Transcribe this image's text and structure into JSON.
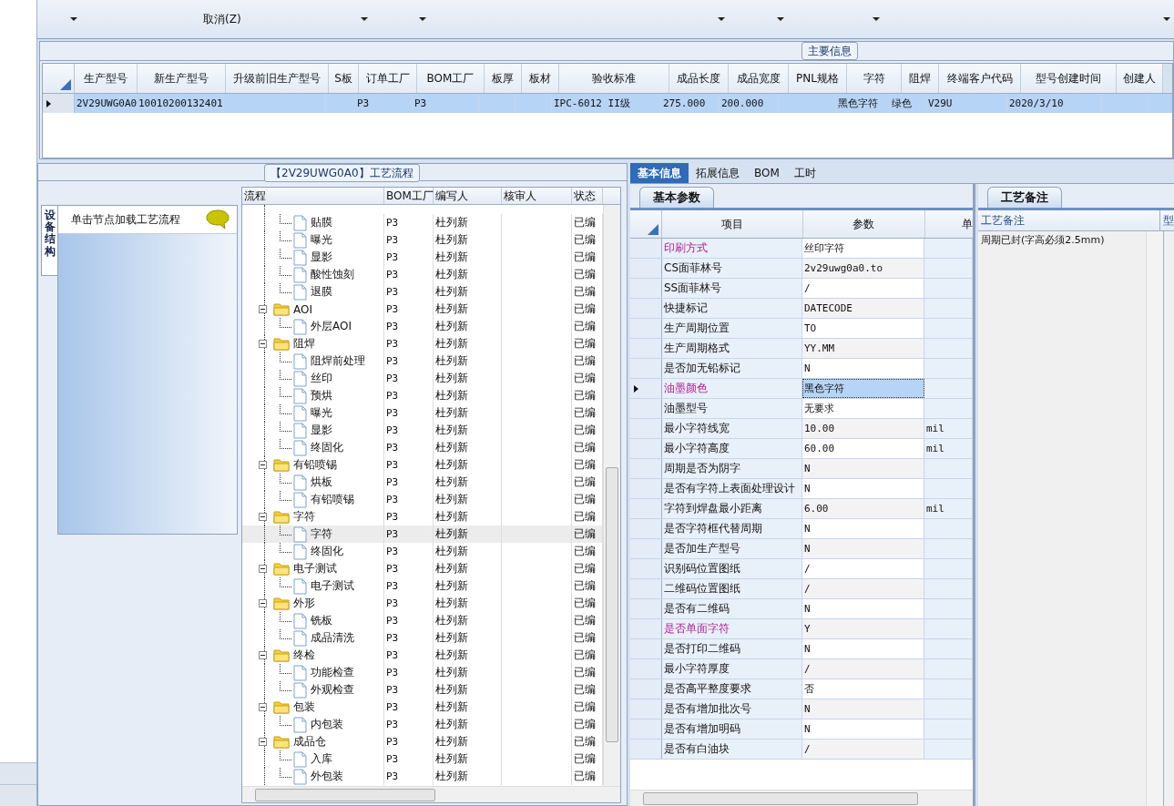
{
  "toolbar": {
    "menu_item": "取消(Z)"
  },
  "main_info": {
    "title": "主要信息",
    "columns": [
      "生产型号",
      "新生产型号",
      "升级前旧生产型号",
      "S板",
      "订单工厂",
      "BOM工厂",
      "板厚",
      "板材",
      "验收标准",
      "成品长度",
      "成品宽度",
      "PNL规格",
      "字符",
      "阻焊",
      "终端客户代码",
      "型号创建时间",
      "创建人"
    ],
    "rows": [
      {
        "selected": true,
        "cells": [
          "2V29UWG0A0",
          "10010200132401",
          null,
          null,
          "P3",
          "P3",
          null,
          null,
          "IPC-6012 II级",
          "275.000",
          "200.000",
          null,
          "黑色字符",
          "绿色",
          "V29U",
          "2020/3/10",
          null
        ]
      }
    ]
  },
  "flow": {
    "title": "【2V29UWG0A0】工艺流程",
    "side_tab": {
      "label": "设备结构",
      "selected": true
    },
    "hint": "单击节点加载工艺流程",
    "columns": [
      "流程",
      "BOM工厂",
      "编写人",
      "核审人",
      "状态"
    ],
    "tree": [
      {
        "children": [
          {
            "name": "贴膜",
            "bom": "P3",
            "writer": "杜列新",
            "status": "已编",
            "selected": false
          },
          {
            "name": "曝光",
            "bom": "P3",
            "writer": "杜列新",
            "status": "已编",
            "selected": false
          },
          {
            "name": "显影",
            "bom": "P3",
            "writer": "杜列新",
            "status": "已编",
            "selected": false
          },
          {
            "name": "酸性蚀刻",
            "bom": "P3",
            "writer": "杜列新",
            "status": "已编",
            "selected": false
          },
          {
            "name": "退膜",
            "bom": "P3",
            "writer": "杜列新",
            "status": "已编",
            "selected": false
          }
        ]
      },
      {
        "name": "AOI",
        "bom": "P3",
        "writer": "杜列新",
        "status": "已编",
        "expanded": true,
        "children": [
          {
            "name": "外层AOI",
            "bom": "P3",
            "writer": "杜列新",
            "status": "已编",
            "selected": false
          }
        ]
      },
      {
        "name": "阻焊",
        "bom": "P3",
        "writer": "杜列新",
        "status": "已编",
        "expanded": true,
        "children": [
          {
            "name": "阻焊前处理",
            "bom": "P3",
            "writer": "杜列新",
            "status": "已编",
            "selected": false
          },
          {
            "name": "丝印",
            "bom": "P3",
            "writer": "杜列新",
            "status": "已编",
            "selected": false
          },
          {
            "name": "预烘",
            "bom": "P3",
            "writer": "杜列新",
            "status": "已编",
            "selected": false
          },
          {
            "name": "曝光",
            "bom": "P3",
            "writer": "杜列新",
            "status": "已编",
            "selected": false
          },
          {
            "name": "显影",
            "bom": "P3",
            "writer": "杜列新",
            "status": "已编",
            "selected": false
          },
          {
            "name": "终固化",
            "bom": "P3",
            "writer": "杜列新",
            "status": "已编",
            "selected": false
          }
        ]
      },
      {
        "name": "有铅喷锡",
        "bom": "P3",
        "writer": "杜列新",
        "status": "已编",
        "expanded": true,
        "children": [
          {
            "name": "烘板",
            "bom": "P3",
            "writer": "杜列新",
            "status": "已编",
            "selected": false
          },
          {
            "name": "有铅喷锡",
            "bom": "P3",
            "writer": "杜列新",
            "status": "已编",
            "selected": false
          }
        ]
      },
      {
        "name": "字符",
        "bom": "P3",
        "writer": "杜列新",
        "status": "已编",
        "expanded": true,
        "children": [
          {
            "name": "字符",
            "bom": "P3",
            "writer": "杜列新",
            "status": "已编",
            "selected": true
          },
          {
            "name": "终固化",
            "bom": "P3",
            "writer": "杜列新",
            "status": "已编",
            "selected": false
          }
        ]
      },
      {
        "name": "电子测试",
        "bom": "P3",
        "writer": "杜列新",
        "status": "已编",
        "expanded": true,
        "children": [
          {
            "name": "电子测试",
            "bom": "P3",
            "writer": "杜列新",
            "status": "已编",
            "selected": false
          }
        ]
      },
      {
        "name": "外形",
        "bom": "P3",
        "writer": "杜列新",
        "status": "已编",
        "expanded": true,
        "children": [
          {
            "name": "铣板",
            "bom": "P3",
            "writer": "杜列新",
            "status": "已编",
            "selected": false
          },
          {
            "name": "成品清洗",
            "bom": "P3",
            "writer": "杜列新",
            "status": "已编",
            "selected": false
          }
        ]
      },
      {
        "name": "终检",
        "bom": "P3",
        "writer": "杜列新",
        "status": "已编",
        "expanded": true,
        "children": [
          {
            "name": "功能检查",
            "bom": "P3",
            "writer": "杜列新",
            "status": "已编",
            "selected": false
          },
          {
            "name": "外观检查",
            "bom": "P3",
            "writer": "杜列新",
            "status": "已编",
            "selected": false
          }
        ]
      },
      {
        "name": "包装",
        "bom": "P3",
        "writer": "杜列新",
        "status": "已编",
        "expanded": true,
        "children": [
          {
            "name": "内包装",
            "bom": "P3",
            "writer": "杜列新",
            "status": "已编",
            "selected": false
          }
        ]
      },
      {
        "name": "成品仓",
        "bom": "P3",
        "writer": "杜列新",
        "status": "已编",
        "expanded": true,
        "children": [
          {
            "name": "入库",
            "bom": "P3",
            "writer": "杜列新",
            "status": "已编",
            "selected": false
          },
          {
            "name": "外包装",
            "bom": "P3",
            "writer": "杜列新",
            "status": "已编",
            "selected": false
          }
        ]
      }
    ]
  },
  "detail_tabs": [
    {
      "label": "基本信息",
      "selected": true
    },
    {
      "label": "拓展信息",
      "selected": false
    },
    {
      "label": "BOM",
      "selected": false
    },
    {
      "label": "工时",
      "selected": false
    }
  ],
  "params": {
    "tab": {
      "label": "基本参数",
      "selected": true
    },
    "columns": [
      "项目",
      "参数",
      "单"
    ],
    "rows": [
      {
        "item": "印刷方式",
        "value": "丝印字符",
        "emphasized": true,
        "selected": false
      },
      {
        "item": "CS面菲林号",
        "value": "2v29uwg0a0.to",
        "emphasized": false,
        "selected": false
      },
      {
        "item": "SS面菲林号",
        "value": "/",
        "emphasized": false,
        "selected": false
      },
      {
        "item": "快捷标记",
        "value": "DATECODE",
        "emphasized": false,
        "selected": false
      },
      {
        "item": "生产周期位置",
        "value": "TO",
        "emphasized": false,
        "selected": false
      },
      {
        "item": "生产周期格式",
        "value": "YY.MM",
        "emphasized": false,
        "selected": false
      },
      {
        "item": "是否加无铅标记",
        "value": "N",
        "emphasized": false,
        "selected": false
      },
      {
        "item": "油墨颜色",
        "value": "黑色字符",
        "emphasized": true,
        "selected": true
      },
      {
        "item": "油墨型号",
        "value": "无要求",
        "emphasized": false,
        "selected": false
      },
      {
        "item": "最小字符线宽",
        "value": "10.00",
        "unit": "mil",
        "emphasized": false,
        "selected": false
      },
      {
        "item": "最小字符高度",
        "value": "60.00",
        "unit": "mil",
        "emphasized": false,
        "selected": false
      },
      {
        "item": "周期是否为阴字",
        "value": "N",
        "emphasized": false,
        "selected": false
      },
      {
        "item": "是否有字符上表面处理设计",
        "value": "N",
        "emphasized": false,
        "selected": false
      },
      {
        "item": "字符到焊盘最小距离",
        "value": "6.00",
        "unit": "mil",
        "emphasized": false,
        "selected": false
      },
      {
        "item": "是否字符框代替周期",
        "value": "N",
        "emphasized": false,
        "selected": false
      },
      {
        "item": "是否加生产型号",
        "value": "N",
        "emphasized": false,
        "selected": false
      },
      {
        "item": "识别码位置图纸",
        "value": "/",
        "emphasized": false,
        "selected": false
      },
      {
        "item": "二维码位置图纸",
        "value": "/",
        "emphasized": false,
        "selected": false
      },
      {
        "item": "是否有二维码",
        "value": "N",
        "emphasized": false,
        "selected": false
      },
      {
        "item": "是否单面字符",
        "value": "Y",
        "emphasized": true,
        "selected": false
      },
      {
        "item": "是否打印二维码",
        "value": "N",
        "emphasized": false,
        "selected": false
      },
      {
        "item": "最小字符厚度",
        "value": "/",
        "emphasized": false,
        "selected": false
      },
      {
        "item": "是否高平整度要求",
        "value": "否",
        "emphasized": false,
        "selected": false
      },
      {
        "item": "是否有增加批次号",
        "value": "N",
        "emphasized": false,
        "selected": false
      },
      {
        "item": "是否有增加明码",
        "value": "N",
        "emphasized": false,
        "selected": false
      },
      {
        "item": "是否有白油块",
        "value": "/",
        "emphasized": false,
        "selected": false
      }
    ]
  },
  "notes": {
    "tab": {
      "label": "工艺备注",
      "selected": true
    },
    "columns": [
      "工艺备注",
      "型"
    ],
    "rows": [
      "周期已封(字高必须2.5mm)"
    ]
  }
}
